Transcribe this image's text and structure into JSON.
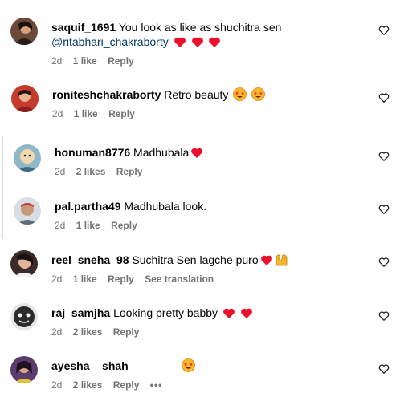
{
  "comments": [
    {
      "username": "saquif_1691",
      "text": "You look as like as shuchitra sen",
      "mention": "@ritabhari_chakraborty",
      "emoji": [
        "red-heart-icon",
        "red-heart-icon",
        "red-heart-icon"
      ],
      "time": "2d",
      "likes": "1 like",
      "reply": "Reply"
    },
    {
      "username": "roniteshchakraborty",
      "text": "Retro beauty",
      "emoji": [
        "star-struck-emoji-icon",
        "star-struck-emoji-icon"
      ],
      "time": "2d",
      "likes": "1 like",
      "reply": "Reply"
    },
    {
      "username": "honuman8776",
      "text": "Madhubala",
      "emoji": [
        "red-heart-icon"
      ],
      "time": "2d",
      "likes": "2 likes",
      "reply": "Reply"
    },
    {
      "username": "pal.partha49",
      "text": "Madhubala look.",
      "time": "2d",
      "likes": "1 like",
      "reply": "Reply"
    },
    {
      "username": "reel_sneha_98",
      "text": "Suchitra Sen lagche puro",
      "emoji": [
        "red-heart-icon",
        "raising-hands-emoji-icon"
      ],
      "time": "2d",
      "likes": "1 like",
      "reply": "Reply",
      "translate": "See translation"
    },
    {
      "username": "raj_samjha",
      "text": "Looking pretty babby",
      "emoji": [
        "red-heart-icon",
        "red-heart-icon"
      ],
      "time": "2d",
      "likes": "2 likes",
      "reply": "Reply"
    },
    {
      "username": "ayesha__shah_______",
      "text": "",
      "emoji": [
        "star-struck-emoji-icon"
      ],
      "time": "2d",
      "likes": "2 likes",
      "reply": "Reply",
      "more": "•••"
    }
  ],
  "colors": {
    "username": "#000000",
    "meta": "#737373",
    "mention": "#00376b",
    "heart": "#ed0f2c",
    "emoji_face": "#f9b72c",
    "divider": "#dbdbdb"
  }
}
